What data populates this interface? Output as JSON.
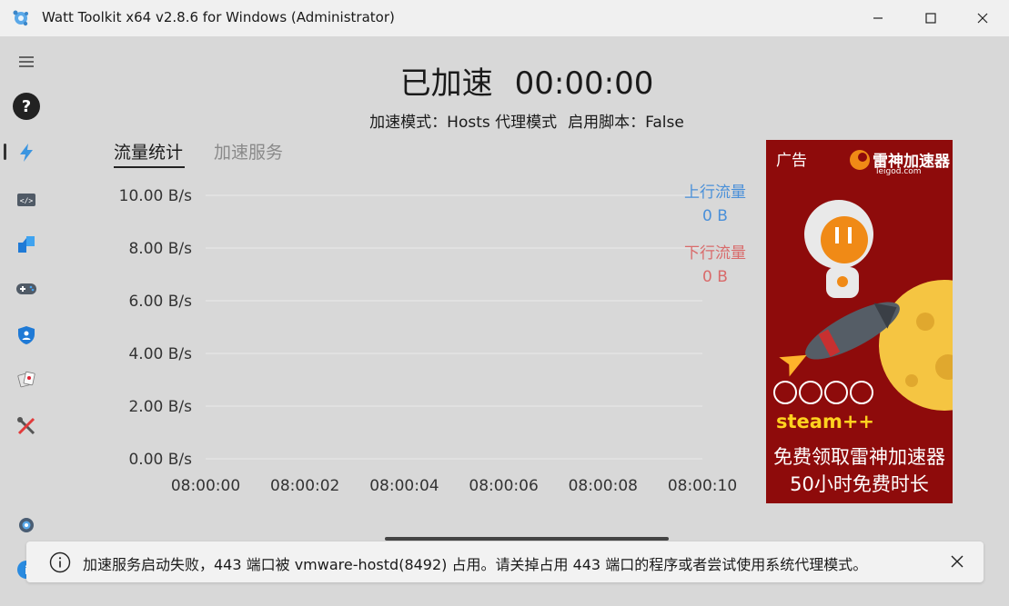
{
  "window": {
    "title": "Watt Toolkit x64 v2.8.6 for Windows (Administrator)",
    "minimize_icon": "minimize-icon",
    "maximize_icon": "maximize-icon",
    "close_icon": "close-icon"
  },
  "sidebar": {
    "items": [
      {
        "name": "menu",
        "icon": "hamburger-icon"
      },
      {
        "name": "help",
        "icon": "question-icon"
      },
      {
        "name": "accelerator",
        "icon": "lightning-icon",
        "active": true
      },
      {
        "name": "script",
        "icon": "code-icon"
      },
      {
        "name": "account-switch",
        "icon": "arrows-icon"
      },
      {
        "name": "game-list",
        "icon": "gamepad-icon"
      },
      {
        "name": "authenticator",
        "icon": "shield-icon"
      },
      {
        "name": "idle-cards",
        "icon": "cards-icon"
      },
      {
        "name": "tools",
        "icon": "tools-icon"
      },
      {
        "name": "settings",
        "icon": "gear-icon"
      },
      {
        "name": "about",
        "icon": "info-icon"
      }
    ]
  },
  "header": {
    "status": "已加速",
    "timer": "00:00:00",
    "mode_label": "加速模式：",
    "mode_value": "Hosts 代理模式",
    "script_label": "启用脚本：",
    "script_value": "False"
  },
  "tabs": [
    {
      "label": "流量统计",
      "active": true
    },
    {
      "label": "加速服务",
      "active": false
    }
  ],
  "legend": {
    "upload_label": "上行流量",
    "upload_value": "0 B",
    "download_label": "下行流量",
    "download_value": "0 B"
  },
  "chart_data": {
    "type": "line",
    "title": "",
    "xlabel": "",
    "ylabel": "",
    "x": [
      "08:00:00",
      "08:00:02",
      "08:00:04",
      "08:00:06",
      "08:00:08",
      "08:00:10"
    ],
    "y_ticks": [
      "0.00 B/s",
      "2.00 B/s",
      "4.00 B/s",
      "6.00 B/s",
      "8.00 B/s",
      "10.00 B/s"
    ],
    "ylim": [
      0,
      10
    ],
    "series": [
      {
        "name": "上行流量",
        "values": [],
        "color": "#4a90d9"
      },
      {
        "name": "下行流量",
        "values": [],
        "color": "#d96b6b"
      }
    ],
    "grid": true,
    "legend": "top-right"
  },
  "ad": {
    "tag": "广告",
    "brand": "雷神加速器",
    "domain": "leigod.com",
    "product": "steam++",
    "line1": "免费领取雷神加速器",
    "line2": "50小时免费时长"
  },
  "toast": {
    "icon": "info-icon",
    "message": "加速服务启动失败，443 端口被 vmware-hostd(8492) 占用。请关掉占用 443 端口的程序或者尝试使用系统代理模式。"
  }
}
